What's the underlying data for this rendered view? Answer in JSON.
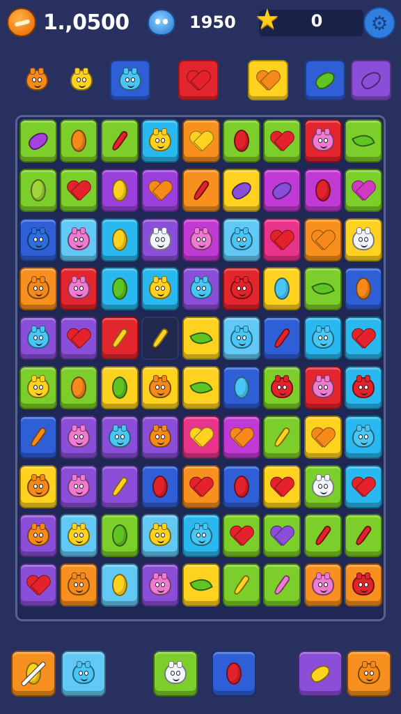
{
  "hud": {
    "coins": "1.,0500",
    "coin_icon": "coin-icon",
    "gems": "1950",
    "gem_icon": "blue-monster-icon",
    "stars": "0",
    "star_icon": "star-icon",
    "settings_icon": "gear-icon"
  },
  "colors": {
    "background": "#27305e",
    "board": "#1f2754",
    "tiles": {
      "green": "#7ccf2a",
      "orange": "#f7901e",
      "yellow": "#ffd21f",
      "purple": "#9b3fdc",
      "magenta": "#c13ad6",
      "pink": "#e8348a",
      "red": "#e3262e",
      "cyan": "#29b8ef",
      "blue": "#2f5fd6",
      "lightblue": "#62c8f5",
      "violet": "#8a4ed8"
    }
  },
  "goals": [
    {
      "piece": "orange-blob",
      "boxed": false,
      "tile": "",
      "icon": "orange-monster-icon"
    },
    {
      "piece": "yellow-blob",
      "boxed": false,
      "tile": "",
      "icon": "yellow-monster-icon"
    },
    {
      "piece": "cyan-blob",
      "boxed": true,
      "tile": "blue",
      "icon": "blue-monster-icon"
    },
    {
      "piece": "red-heart",
      "boxed": true,
      "tile": "red",
      "icon": "red-heart-icon"
    },
    {
      "piece": "orange-heart",
      "boxed": true,
      "tile": "yellow",
      "icon": "orange-heart-icon"
    },
    {
      "piece": "green-bean",
      "boxed": true,
      "tile": "blue",
      "icon": "green-pepper-icon"
    },
    {
      "piece": "violet-bean",
      "boxed": true,
      "tile": "violet",
      "icon": "purple-eggplant-icon"
    }
  ],
  "board": {
    "rows": [
      [
        "green:purple:bean",
        "green:orange:oval",
        "green:red:carrot",
        "cyan:yellow:blob",
        "orange:yellow:heart",
        "green:red:oval",
        "green:red:heart",
        "red:pink:blob",
        "green:green:leaf"
      ],
      [
        "green:olive:oval",
        "green:red:heart",
        "purple:yellow:oval",
        "purple:orange:heart",
        "orange:red:carrot",
        "yellow:violet:bean",
        "magenta:violet:bean",
        "magenta:red:oval",
        "green:magenta:heart"
      ],
      [
        "blue:blue:blob",
        "lightblue:pink:blob",
        "cyan:yellow:oval",
        "violet:white:blob",
        "magenta:pink:blob",
        "lightblue:cyan:blob",
        "pink:red:heart",
        "orange:orange:heart",
        "yellow:white:blob"
      ],
      [
        "orange:orange:blob",
        "red:pink:blob",
        "cyan:green:oval",
        "cyan:yellow:blob",
        "violet:cyan:blob",
        "red:red:blob",
        "yellow:cyan:oval",
        "green:green:leaf",
        "blue:orange:oval"
      ],
      [
        "violet:cyan:blob",
        "violet:red:heart",
        "red:yellow:carrot",
        "empty:yellow:carrot",
        "yellow:green:leaf",
        "lightblue:cyan:blob",
        "blue:red:carrot",
        "cyan:cyan:blob",
        "cyan:red:heart"
      ],
      [
        "green:yellow:blob",
        "green:orange:oval",
        "yellow:green:oval",
        "yellow:orange:blob",
        "yellow:green:leaf",
        "blue:cyan:oval",
        "green:red:blob",
        "red:pink:blob",
        "cyan:red:blob"
      ],
      [
        "blue:orange:carrot",
        "violet:pink:blob",
        "violet:cyan:blob",
        "violet:orange:blob",
        "pink:yellow:heart",
        "magenta:orange:heart",
        "green:yellow:carrot",
        "yellow:orange:heart",
        "cyan:cyan:blob"
      ],
      [
        "yellow:orange:blob",
        "violet:pink:blob",
        "violet:yellow:carrot",
        "blue:red:oval",
        "orange:red:heart",
        "blue:red:oval",
        "yellow:red:heart",
        "green:white:blob",
        "cyan:red:heart"
      ],
      [
        "violet:orange:blob",
        "lightblue:yellow:blob",
        "green:green:oval",
        "lightblue:yellow:blob",
        "cyan:cyan:blob",
        "green:red:heart",
        "green:violet:heart",
        "green:red:carrot",
        "green:red:carrot"
      ],
      [
        "violet:red:heart",
        "orange:orange:blob",
        "lightblue:yellow:oval",
        "violet:pink:blob",
        "yellow:green:leaf",
        "green:yellow:carrot",
        "green:pink:carrot",
        "orange:pink:blob",
        "orange:red:blob"
      ]
    ]
  },
  "boosters": [
    {
      "name": "crossed-orange-boost",
      "tile": "orange",
      "icon": "crossed-ball-icon"
    },
    {
      "name": "blue-monster-boost",
      "tile": "lightblue",
      "icon": "blue-monster-icon"
    },
    {
      "name": "white-monster-boost",
      "tile": "green",
      "icon": "white-monster-icon"
    },
    {
      "name": "red-bomb-boost",
      "tile": "blue",
      "icon": "red-bomb-icon"
    },
    {
      "name": "banana-boost",
      "tile": "violet",
      "icon": "banana-icon"
    },
    {
      "name": "orange-monster-boost",
      "tile": "orange",
      "icon": "orange-monster-icon"
    }
  ]
}
